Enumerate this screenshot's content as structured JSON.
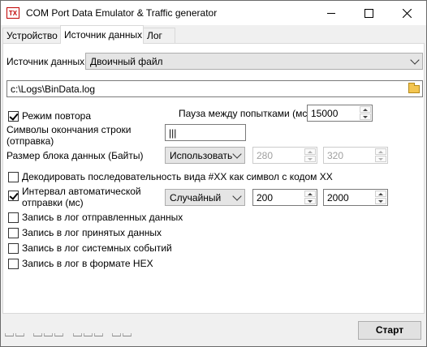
{
  "window": {
    "icon_text": "TX",
    "title": "COM Port Data Emulator & Traffic generator"
  },
  "tabs": [
    {
      "label": "Устройство",
      "active": false
    },
    {
      "label": "Источник данных",
      "active": true
    },
    {
      "label": "Лог",
      "active": false
    }
  ],
  "source": {
    "label": "Источник данных",
    "selected": "Двоичный файл"
  },
  "file_path": "c:\\Logs\\BinData.log",
  "repeat_mode": {
    "label": "Режим повтора",
    "checked": true
  },
  "pause": {
    "label": "Пауза между попытками (мс)",
    "value": "15000"
  },
  "line_end": {
    "label_line1": "Символы окончания строки",
    "label_line2": "(отправка)",
    "value": "|||"
  },
  "block_size": {
    "label": "Размер блока данных (Байты)",
    "mode": "Использовать",
    "min": "280",
    "max": "320"
  },
  "decode": {
    "label": "Декодировать последовательность вида #XX как символ с кодом XX",
    "checked": false
  },
  "auto_interval": {
    "label_line1": "Интервал автоматической",
    "label_line2": "отправки (мс)",
    "checked": true,
    "mode": "Случайный",
    "min": "200",
    "max": "2000"
  },
  "log_options": [
    {
      "label": "Запись в лог отправленных данных",
      "checked": false
    },
    {
      "label": "Запись в лог принятых данных",
      "checked": false
    },
    {
      "label": "Запись в лог системных событий",
      "checked": false
    },
    {
      "label": "Запись в лог в формате HEX",
      "checked": false
    }
  ],
  "start_button": "Старт",
  "colors": {
    "accent_icon": "#c00000",
    "folder": "#f3c550"
  }
}
